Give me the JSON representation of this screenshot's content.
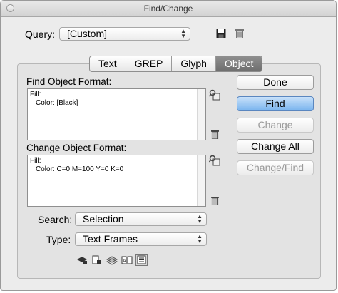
{
  "window": {
    "title": "Find/Change"
  },
  "query": {
    "label": "Query:",
    "value": "[Custom]"
  },
  "tabs": [
    {
      "label": "Text",
      "selected": false
    },
    {
      "label": "GREP",
      "selected": false
    },
    {
      "label": "Glyph",
      "selected": false
    },
    {
      "label": "Object",
      "selected": true
    }
  ],
  "find": {
    "label": "Find Object Format:",
    "line1": "Fill:",
    "line2": "Color: [Black]"
  },
  "change": {
    "label": "Change Object Format:",
    "line1": "Fill:",
    "line2": "Color: C=0 M=100 Y=0 K=0"
  },
  "buttons": {
    "done": "Done",
    "find": "Find",
    "change": "Change",
    "change_all": "Change All",
    "change_find": "Change/Find"
  },
  "search": {
    "label": "Search:",
    "value": "Selection"
  },
  "type": {
    "label": "Type:",
    "value": "Text Frames"
  },
  "colors": {
    "accent": "#7ab4ee",
    "selected_tab": "#6e6e6e"
  },
  "icons": [
    "save-icon",
    "trash-icon",
    "find-format-icon",
    "change-format-icon",
    "locked-layers-icon",
    "locked-stories-icon",
    "hidden-layers-icon",
    "master-pages-icon",
    "footnotes-icon"
  ]
}
